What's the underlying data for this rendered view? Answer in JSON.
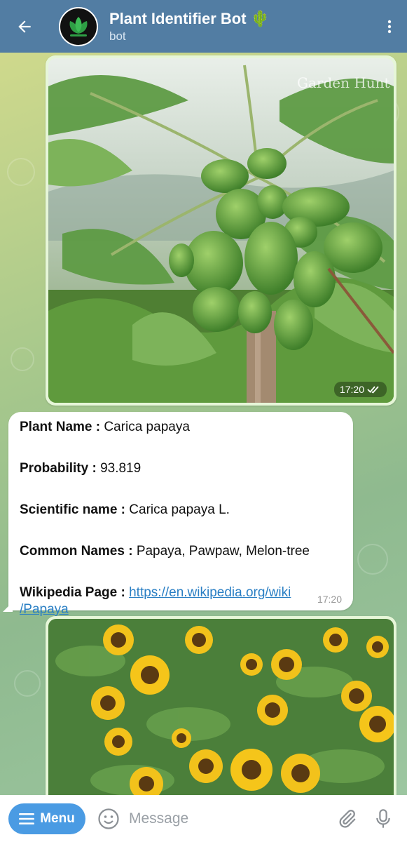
{
  "header": {
    "title": "Plant Identifier Bot",
    "title_emoji": "🌵",
    "subtitle": "bot"
  },
  "photo1": {
    "time": "17:20",
    "watermark": "Garden Hunt"
  },
  "bot_message": {
    "plant_name_label": "Plant Name :",
    "plant_name_value": "Carica papaya",
    "probability_label": "Probability :",
    "probability_value": "93.819",
    "scientific_label": "Scientific name :",
    "scientific_value": "Carica papaya L.",
    "common_label": "Common Names :",
    "common_value": "Papaya, Pawpaw, Melon-tree",
    "wiki_label": "Wikipedia Page :",
    "wiki_link_part1": "https://en.wikipedia.org/wiki",
    "wiki_link_part2": "/Papaya",
    "time": "17:20"
  },
  "composer": {
    "menu_label": "Menu",
    "placeholder": "Message"
  },
  "colors": {
    "header_bg": "#527da3",
    "menu_button": "#4a9be3",
    "link": "#2a7fc4",
    "outgoing_bubble": "#e6f6d8"
  }
}
